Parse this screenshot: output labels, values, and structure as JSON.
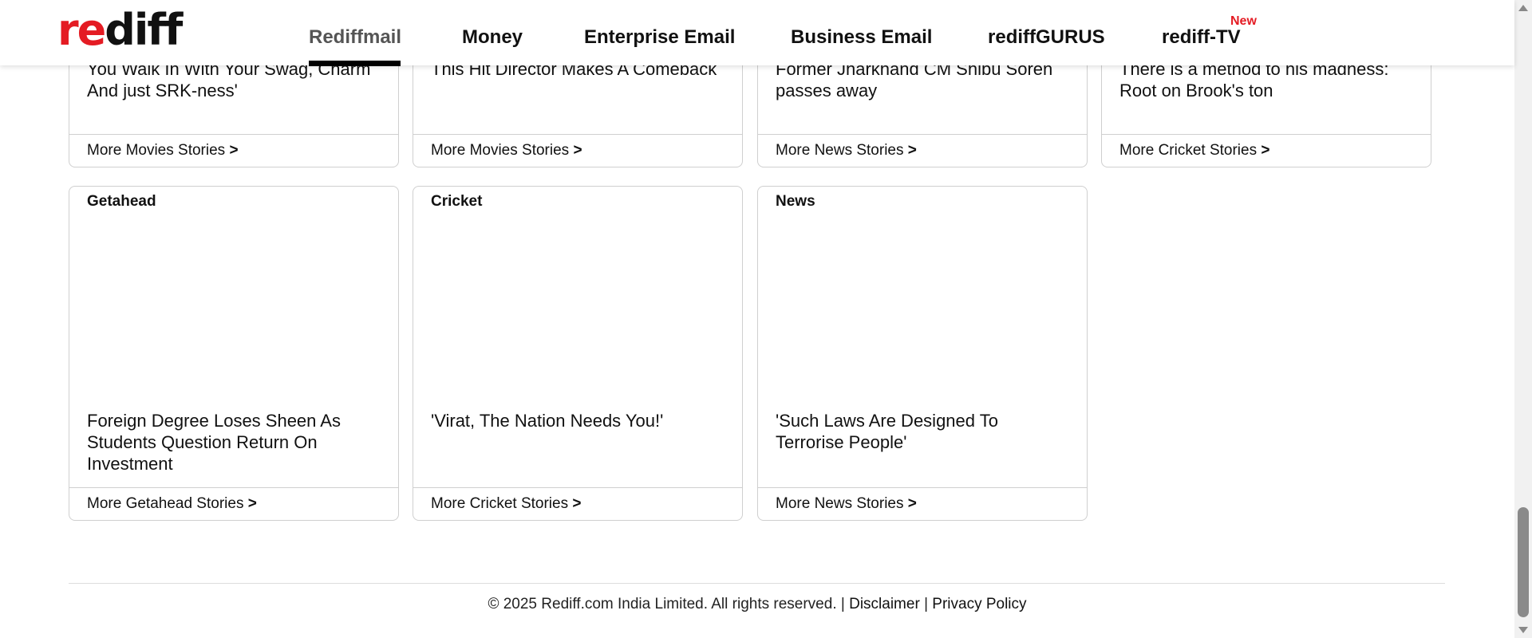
{
  "logo": {
    "red_part": "re",
    "dark_part": "diff"
  },
  "nav": {
    "items": [
      {
        "label": "Rediffmail"
      },
      {
        "label": "Money"
      },
      {
        "label": "Enterprise Email"
      },
      {
        "label": "Business Email"
      },
      {
        "label": "rediffGURUS"
      },
      {
        "label": "rediff-TV"
      }
    ],
    "active_item": "Rediffmail",
    "new_badge": "New"
  },
  "cards_row1": [
    {
      "title": "You Walk In With Your Swag, Charm And just SRK-ness'",
      "footer": "More Movies Stories",
      "arrow": ">"
    },
    {
      "title": "This Hit Director Makes A Comeback",
      "footer": "More Movies Stories",
      "arrow": ">"
    },
    {
      "title": "Former Jharkhand CM Shibu Soren passes away",
      "footer": "More News Stories",
      "arrow": ">"
    },
    {
      "title": "There is a method to his madness: Root on Brook's ton",
      "footer": "More Cricket Stories",
      "arrow": ">"
    }
  ],
  "cards_row2": [
    {
      "category": "Getahead",
      "title": "Foreign Degree Loses Sheen As Students Question Return On Investment",
      "footer": "More Getahead Stories",
      "arrow": ">"
    },
    {
      "category": "Cricket",
      "title": "'Virat, The Nation Needs You!'",
      "footer": "More Cricket Stories",
      "arrow": ">"
    },
    {
      "category": "News",
      "title": "'Such Laws Are Designed To Terrorise People'",
      "footer": "More News Stories",
      "arrow": ">"
    }
  ],
  "footer": {
    "copyright": "© 2025 Rediff.com India Limited. All rights reserved. |",
    "disclaimer": "Disclaimer",
    "separator": "|",
    "privacy": "Privacy Policy"
  },
  "colors": {
    "brand_red": "#e41b23",
    "text": "#111111",
    "border": "#cfcfcf"
  }
}
